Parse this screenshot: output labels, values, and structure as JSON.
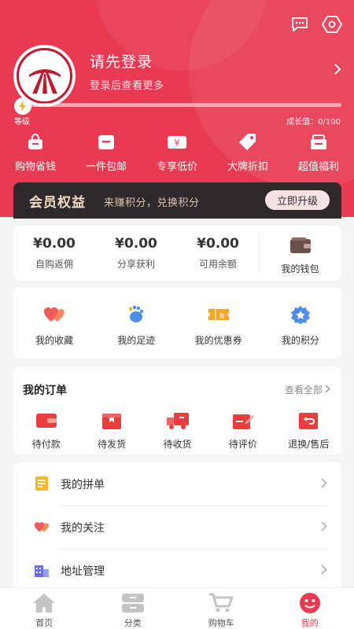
{
  "header": {
    "login_title": "请先登录",
    "login_subtitle": "登录后查看更多",
    "level_label": "等级",
    "growth_label": "成长值：0/100",
    "level_progress": 0.0
  },
  "perks": [
    {
      "label": "购物省钱",
      "icon": "bag-icon"
    },
    {
      "label": "一件包邮",
      "icon": "box-icon"
    },
    {
      "label": "专享低价",
      "icon": "yen-tag-icon"
    },
    {
      "label": "大牌折扣",
      "icon": "tag-icon"
    },
    {
      "label": "超值福利",
      "icon": "gift-box-icon"
    }
  ],
  "vip": {
    "title": "会员权益",
    "subtitle": "来赚积分，兑换积分",
    "button": "立即升级"
  },
  "wallet": {
    "items": [
      {
        "amount": "¥0.00",
        "label": "自购返佣"
      },
      {
        "amount": "¥0.00",
        "label": "分享获利"
      },
      {
        "amount": "¥0.00",
        "label": "可用余额"
      }
    ],
    "wallet_label": "我的钱包"
  },
  "quick": [
    {
      "label": "我的收藏",
      "icon": "heart-icon"
    },
    {
      "label": "我的足迹",
      "icon": "footprint-icon"
    },
    {
      "label": "我的优惠券",
      "icon": "coupon-icon"
    },
    {
      "label": "我的积分",
      "icon": "medal-icon"
    }
  ],
  "orders": {
    "title": "我的订单",
    "view_all": "查看全部",
    "items": [
      {
        "label": "待付款",
        "icon": "wallet-icon"
      },
      {
        "label": "待发货",
        "icon": "package-icon"
      },
      {
        "label": "待收货",
        "icon": "truck-icon"
      },
      {
        "label": "待评价",
        "icon": "edit-icon"
      },
      {
        "label": "退换/售后",
        "icon": "return-icon"
      }
    ]
  },
  "menu": [
    {
      "label": "我的拼单",
      "icon": "notes-icon"
    },
    {
      "label": "我的关注",
      "icon": "hearts-icon"
    },
    {
      "label": "地址管理",
      "icon": "building-icon"
    }
  ],
  "tabs": [
    {
      "label": "首页",
      "icon": "home-icon"
    },
    {
      "label": "分类",
      "icon": "category-icon"
    },
    {
      "label": "购物车",
      "icon": "cart-icon"
    },
    {
      "label": "我的",
      "icon": "face-icon"
    }
  ],
  "colors": {
    "primary": "#e83a52",
    "vip_bg": "#2e2a2c",
    "vip_text": "#f3dcc4"
  }
}
